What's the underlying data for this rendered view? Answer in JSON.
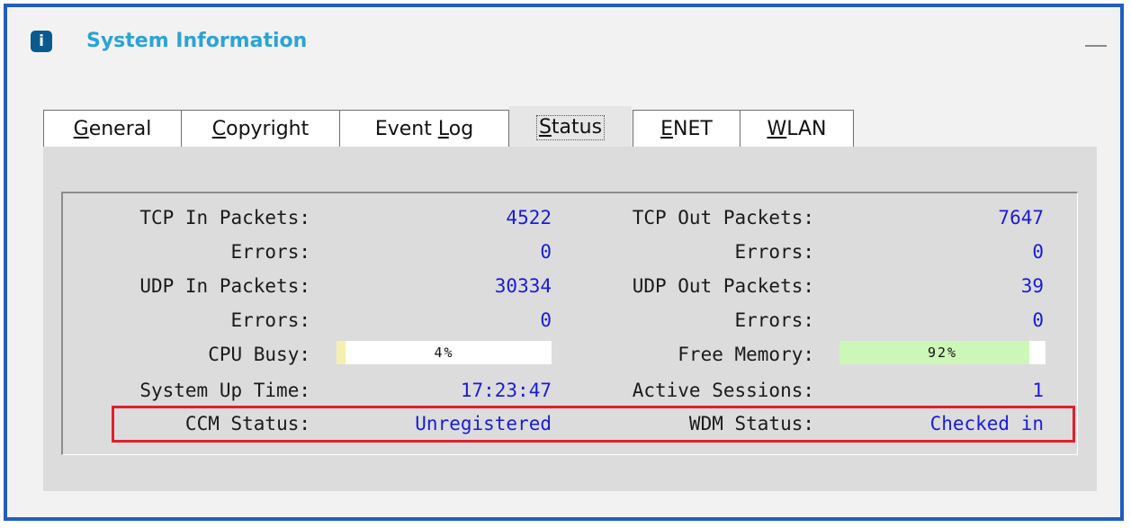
{
  "window": {
    "title": "System Information",
    "info_icon": "i",
    "minimize_label": "—"
  },
  "tabs": [
    {
      "pre": "",
      "key": "G",
      "post": "eneral",
      "active": false
    },
    {
      "pre": "",
      "key": "C",
      "post": "opyright",
      "active": false
    },
    {
      "pre": "Event ",
      "key": "L",
      "post": "og",
      "active": false
    },
    {
      "pre": "",
      "key": "S",
      "post": "tatus",
      "active": true
    },
    {
      "pre": "",
      "key": "E",
      "post": "NET",
      "active": false
    },
    {
      "pre": "",
      "key": "W",
      "post": "LAN",
      "active": false
    }
  ],
  "status": {
    "tcp_in_label": "TCP In Packets:",
    "tcp_in_value": "4522",
    "tcp_in_errors_label": "Errors:",
    "tcp_in_errors_value": "0",
    "tcp_out_label": "TCP Out Packets:",
    "tcp_out_value": "7647",
    "tcp_out_errors_label": "Errors:",
    "tcp_out_errors_value": "0",
    "udp_in_label": "UDP In Packets:",
    "udp_in_value": "30334",
    "udp_in_errors_label": "Errors:",
    "udp_in_errors_value": "0",
    "udp_out_label": "UDP Out Packets:",
    "udp_out_value": "39",
    "udp_out_errors_label": "Errors:",
    "udp_out_errors_value": "0",
    "cpu_label": "CPU Busy:",
    "cpu_text": "4%",
    "cpu_fraction": 0.04,
    "mem_label": "Free Memory:",
    "mem_text": "92%",
    "mem_fraction": 0.92,
    "uptime_label": "System Up Time:",
    "uptime_value": "17:23:47",
    "sessions_label": "Active Sessions:",
    "sessions_value": "1",
    "ccm_label": "CCM Status:",
    "ccm_value": "Unregistered",
    "wdm_label": "WDM Status:",
    "wdm_value": "Checked in"
  },
  "colors": {
    "cpu_fill": "#f5f0b0",
    "mem_fill": "#cdf7b8",
    "highlight": "#e0202c",
    "value_text": "#1b1bd9"
  }
}
